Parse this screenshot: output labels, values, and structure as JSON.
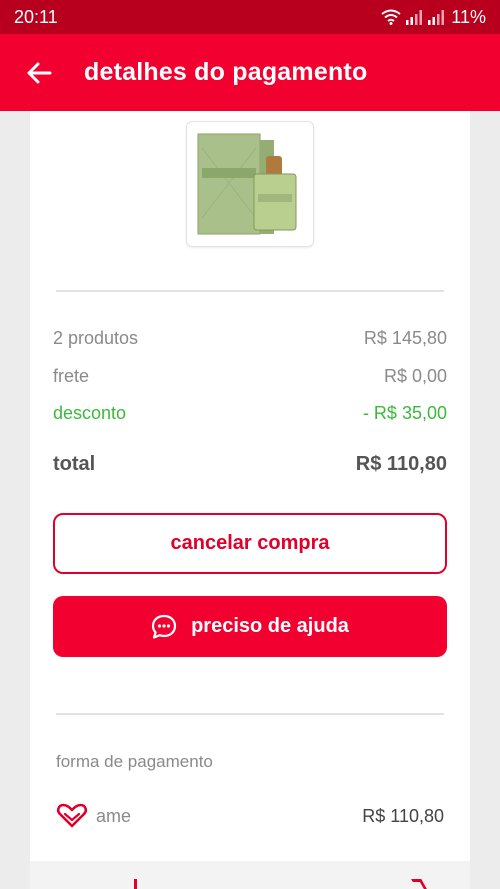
{
  "status_bar": {
    "time": "20:11",
    "battery": "11%",
    "icons": [
      "wifi-icon",
      "signal-icon",
      "signal-icon"
    ]
  },
  "header": {
    "title": "detalhes do pagamento",
    "back_icon": "arrow-left-icon"
  },
  "product": {
    "image_icon": "perfume-product-image"
  },
  "summary": {
    "products_label": "2 produtos",
    "products_value": "R$ 145,80",
    "shipping_label": "frete",
    "shipping_value": "R$ 0,00",
    "discount_label": "desconto",
    "discount_value": "- R$ 35,00",
    "total_label": "total",
    "total_value": "R$ 110,80"
  },
  "actions": {
    "cancel_label": "cancelar compra",
    "help_label": "preciso de ajuda",
    "help_icon": "chat-bubble-icon"
  },
  "payment": {
    "section_label": "forma de pagamento",
    "method_icon": "ame-heart-icon",
    "method_name": "ame",
    "amount": "R$ 110,80"
  },
  "colors": {
    "brand_red": "#f2002f",
    "status_red": "#b8001e",
    "discount_green": "#3cb93c"
  }
}
